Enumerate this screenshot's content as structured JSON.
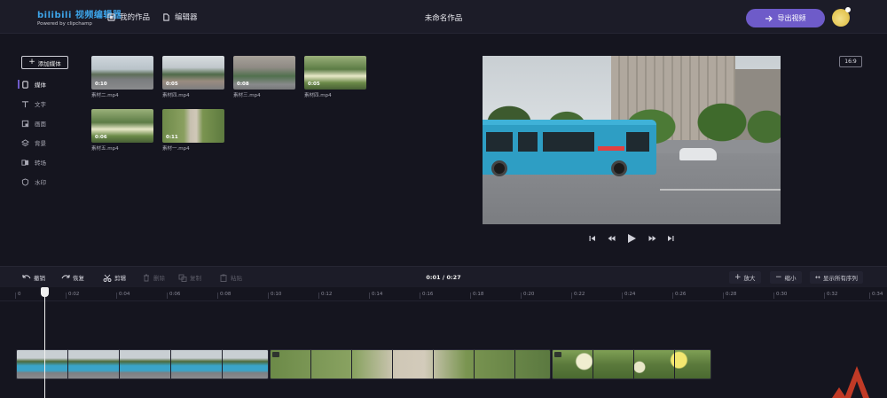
{
  "header": {
    "logo_main": "bilibili 视频编辑器",
    "logo_sub": "Powered by clipchamp",
    "nav": [
      {
        "label": "我的作品"
      },
      {
        "label": "编辑器"
      }
    ],
    "project_title": "未命名作品",
    "export_label": "导出视频"
  },
  "sidebar": {
    "add_media_label": "添加媒体",
    "items": [
      {
        "label": "媒体",
        "icon": "media-icon",
        "active": true
      },
      {
        "label": "文字",
        "icon": "text-icon",
        "active": false
      },
      {
        "label": "画面",
        "icon": "frame-icon",
        "active": false
      },
      {
        "label": "背景",
        "icon": "layers-icon",
        "active": false
      },
      {
        "label": "转场",
        "icon": "transition-icon",
        "active": false
      },
      {
        "label": "水印",
        "icon": "shield-icon",
        "active": false
      }
    ]
  },
  "media": [
    {
      "name": "素材二.mp4",
      "duration": "0:10",
      "style": "street"
    },
    {
      "name": "素材四.mp4",
      "duration": "0:05",
      "style": "gate"
    },
    {
      "name": "素材三.mp4",
      "duration": "0:08",
      "style": "build"
    },
    {
      "name": "素材四.mp4",
      "duration": "0:05",
      "style": "flower"
    },
    {
      "name": "素材五.mp4",
      "duration": "0:06",
      "style": "flower"
    },
    {
      "name": "素材一.mp4",
      "duration": "0:11",
      "style": "path"
    }
  ],
  "preview": {
    "aspect_ratio": "16:9"
  },
  "timeline": {
    "tools": [
      {
        "label": "撤销",
        "enabled": true,
        "icon": "undo-icon"
      },
      {
        "label": "恢复",
        "enabled": true,
        "icon": "redo-icon"
      },
      {
        "label": "剪辑",
        "enabled": true,
        "icon": "scissors-icon"
      },
      {
        "label": "删除",
        "enabled": false,
        "icon": "trash-icon"
      },
      {
        "label": "复制",
        "enabled": false,
        "icon": "copy-icon"
      },
      {
        "label": "粘贴",
        "enabled": false,
        "icon": "paste-icon"
      }
    ],
    "time_display": "0:01 / 0:27",
    "zoom_in_label": "放大",
    "zoom_out_label": "缩小",
    "show_all_label": "显示所有序列",
    "ruler_ticks": [
      "0",
      "0:02",
      "0:04",
      "0:06",
      "0:08",
      "0:10",
      "0:12",
      "0:14",
      "0:16",
      "0:18",
      "0:20",
      "0:22",
      "0:24",
      "0:26",
      "0:28",
      "0:30",
      "0:32",
      "0:34"
    ],
    "clips": [
      {
        "name": "clip-bus"
      },
      {
        "name": "clip-path"
      },
      {
        "name": "clip-flowers"
      }
    ]
  },
  "colors": {
    "accent": "#6e5bc9",
    "brand_blue": "#3da5ea",
    "background": "#15151f"
  }
}
